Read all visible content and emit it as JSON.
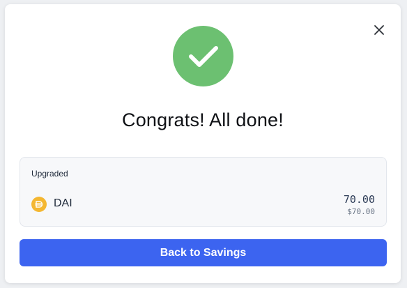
{
  "modal": {
    "title": "Congrats! All done!",
    "close_icon": "close-icon",
    "success_icon": "checkmark-icon",
    "success_color": "#6cc071"
  },
  "summary": {
    "label": "Upgraded",
    "token": {
      "symbol": "DAI",
      "icon": "dai-token-icon",
      "icon_color": "#f4b731",
      "amount": "70.00",
      "usd_value": "$70.00"
    }
  },
  "actions": {
    "back_label": "Back to Savings",
    "accent_color": "#3c64f0"
  }
}
